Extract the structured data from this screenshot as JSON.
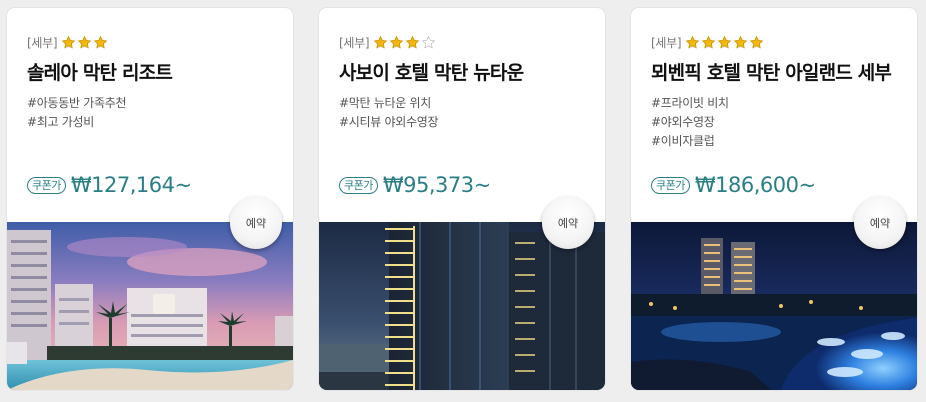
{
  "colors": {
    "accent": "#2a7f87",
    "star": "#f2b70c"
  },
  "hotels": [
    {
      "region": "[세부]",
      "stars": 3,
      "star_total": 3,
      "name": "솔레아 막탄 리조트",
      "tags": [
        "#아동동반 가족추천",
        "#최고 가성비"
      ],
      "coupon_label": "쿠폰가",
      "price": "₩127,164~",
      "reserve_label": "예약",
      "image": "resort-pool-sunset-photo"
    },
    {
      "region": "[세부]",
      "stars": 3,
      "star_total": 4,
      "name": "사보이 호텔 막탄 뉴타운",
      "tags": [
        "#막탄 뉴타운 위치",
        "#시티뷰 야외수영장"
      ],
      "coupon_label": "쿠폰가",
      "price": "₩95,373~",
      "reserve_label": "예약",
      "image": "tower-night-photo"
    },
    {
      "region": "[세부]",
      "stars": 5,
      "star_total": 5,
      "name": "뫼벤픽 호텔 막탄 아일랜드 세부",
      "tags": [
        "#프라이빗 비치",
        "#야외수영장",
        "#이비자클럽"
      ],
      "coupon_label": "쿠폰가",
      "price": "₩186,600~",
      "reserve_label": "예약",
      "image": "beach-club-night-photo"
    }
  ]
}
